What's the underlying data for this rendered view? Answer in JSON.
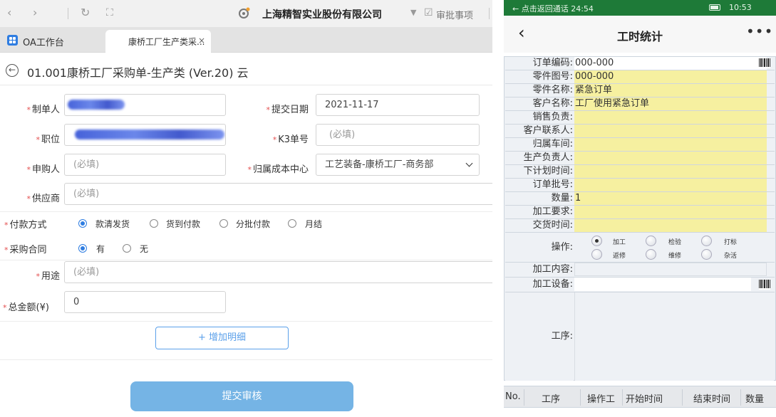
{
  "left": {
    "company": "上海精智实业股份有限公司",
    "approve_label": "审批事项",
    "tabs": [
      {
        "label": "OA工作台"
      },
      {
        "label": "康桥工厂生产类采..."
      }
    ],
    "tab_close": "×",
    "form_title": "01.001康桥工厂采购单-生产类 (Ver.20) 云",
    "fields": {
      "creator_label": "制单人",
      "submit_date_label": "提交日期",
      "submit_date_value": "2021-11-17",
      "position_label": "职位",
      "k3_label": "K3单号",
      "k3_placeholder": "(必填)",
      "requester_label": "申购人",
      "requester_placeholder": "(必填)",
      "cost_center_label": "归属成本中心",
      "cost_center_value": "工艺装备-康桥工厂-商务部",
      "supplier_label": "供应商",
      "supplier_placeholder": "(必填)",
      "payment_label": "付款方式",
      "payment_options": [
        "款清发货",
        "货到付款",
        "分批付款",
        "月结"
      ],
      "payment_selected": "款清发货",
      "contract_label": "采购合同",
      "contract_options": [
        "有",
        "无"
      ],
      "contract_selected": "有",
      "usage_label": "用途",
      "usage_placeholder": "(必填)",
      "total_label": "总金额(¥)",
      "total_value": "0"
    },
    "add_detail_button": "+ 增加明细",
    "submit_button": "提交审核"
  },
  "right": {
    "status_back": "← 点击返回通话 24:54",
    "status_time": "10:53",
    "nav_back": "‹",
    "nav_title": "工时统计",
    "nav_more": "•••",
    "rows": [
      {
        "label": "订单编码:",
        "value": "000-000"
      },
      {
        "label": "零件图号:",
        "value": "000-000"
      },
      {
        "label": "零件名称:",
        "value": "紧急订单"
      },
      {
        "label": "客户名称:",
        "value": "工厂使用紧急订单"
      },
      {
        "label": "销售负责:",
        "value": ""
      },
      {
        "label": "客户联系人:",
        "value": ""
      },
      {
        "label": "归属车间:",
        "value": ""
      },
      {
        "label": "生产负责人:",
        "value": ""
      },
      {
        "label": "下计划时间:",
        "value": ""
      },
      {
        "label": "订单批号:",
        "value": ""
      },
      {
        "label": "数量:",
        "value": "1"
      },
      {
        "label": "加工要求:",
        "value": ""
      },
      {
        "label": "交货时间:",
        "value": ""
      }
    ],
    "operation_label": "操作:",
    "operations": [
      "加工",
      "检验",
      "打标",
      "返修",
      "维修",
      "杂活"
    ],
    "operation_selected": "加工",
    "content_label": "加工内容:",
    "equipment_label": "加工设备:",
    "process_label": "工序:",
    "table_headers": [
      "No.",
      "工序",
      "操作工",
      "开始时间",
      "结束时间",
      "数量"
    ]
  }
}
